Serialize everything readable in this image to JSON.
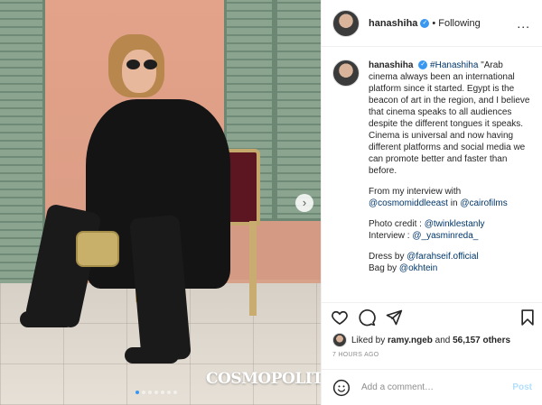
{
  "post": {
    "image_watermark": "COSMOPOLITAN",
    "carousel_total": 7,
    "carousel_active": 1
  },
  "header": {
    "username": "hanashiha",
    "separator": "•",
    "follow_state": "Following",
    "more": "..."
  },
  "caption": {
    "username": "hanashiha",
    "hashtag": "#Hanashiha",
    "quote": "\"Arab cinema always been an international platform since it started. Egypt is the beacon of art in the region, and I believe that cinema speaks to all audiences despite the different tongues it speaks. Cinema is universal and now having different platforms and social media we can promote better and faster than before.",
    "interview_prefix": "From my interview with",
    "interview_mention1": "@cosmomiddleeast",
    "interview_in": "in",
    "interview_mention2": "@cairofilms",
    "photo_prefix": "Photo credit :",
    "photo_mention": "@twinklestanly",
    "interview_label": "Interview :",
    "interview_mention3": "@_yasminreda_",
    "dress_prefix": "Dress by",
    "dress_mention": "@farahseif.official",
    "bag_prefix": "Bag by",
    "bag_mention": "@okhtein"
  },
  "likes": {
    "prefix": "Liked by",
    "user": "ramy.ngeb",
    "connector": "and",
    "count": "56,157 others"
  },
  "timestamp": "7 HOURS AGO",
  "comment": {
    "placeholder": "Add a comment…",
    "post_label": "Post"
  },
  "icons": {
    "like": "heart-icon",
    "comment": "comment-icon",
    "share": "share-icon",
    "save": "bookmark-icon",
    "emoji": "emoji-icon",
    "next": "chevron-right-icon"
  },
  "colors": {
    "link": "#00376b",
    "verified": "#3897f0",
    "post_button": "#b2dffc",
    "muted": "#8e8e8e"
  }
}
